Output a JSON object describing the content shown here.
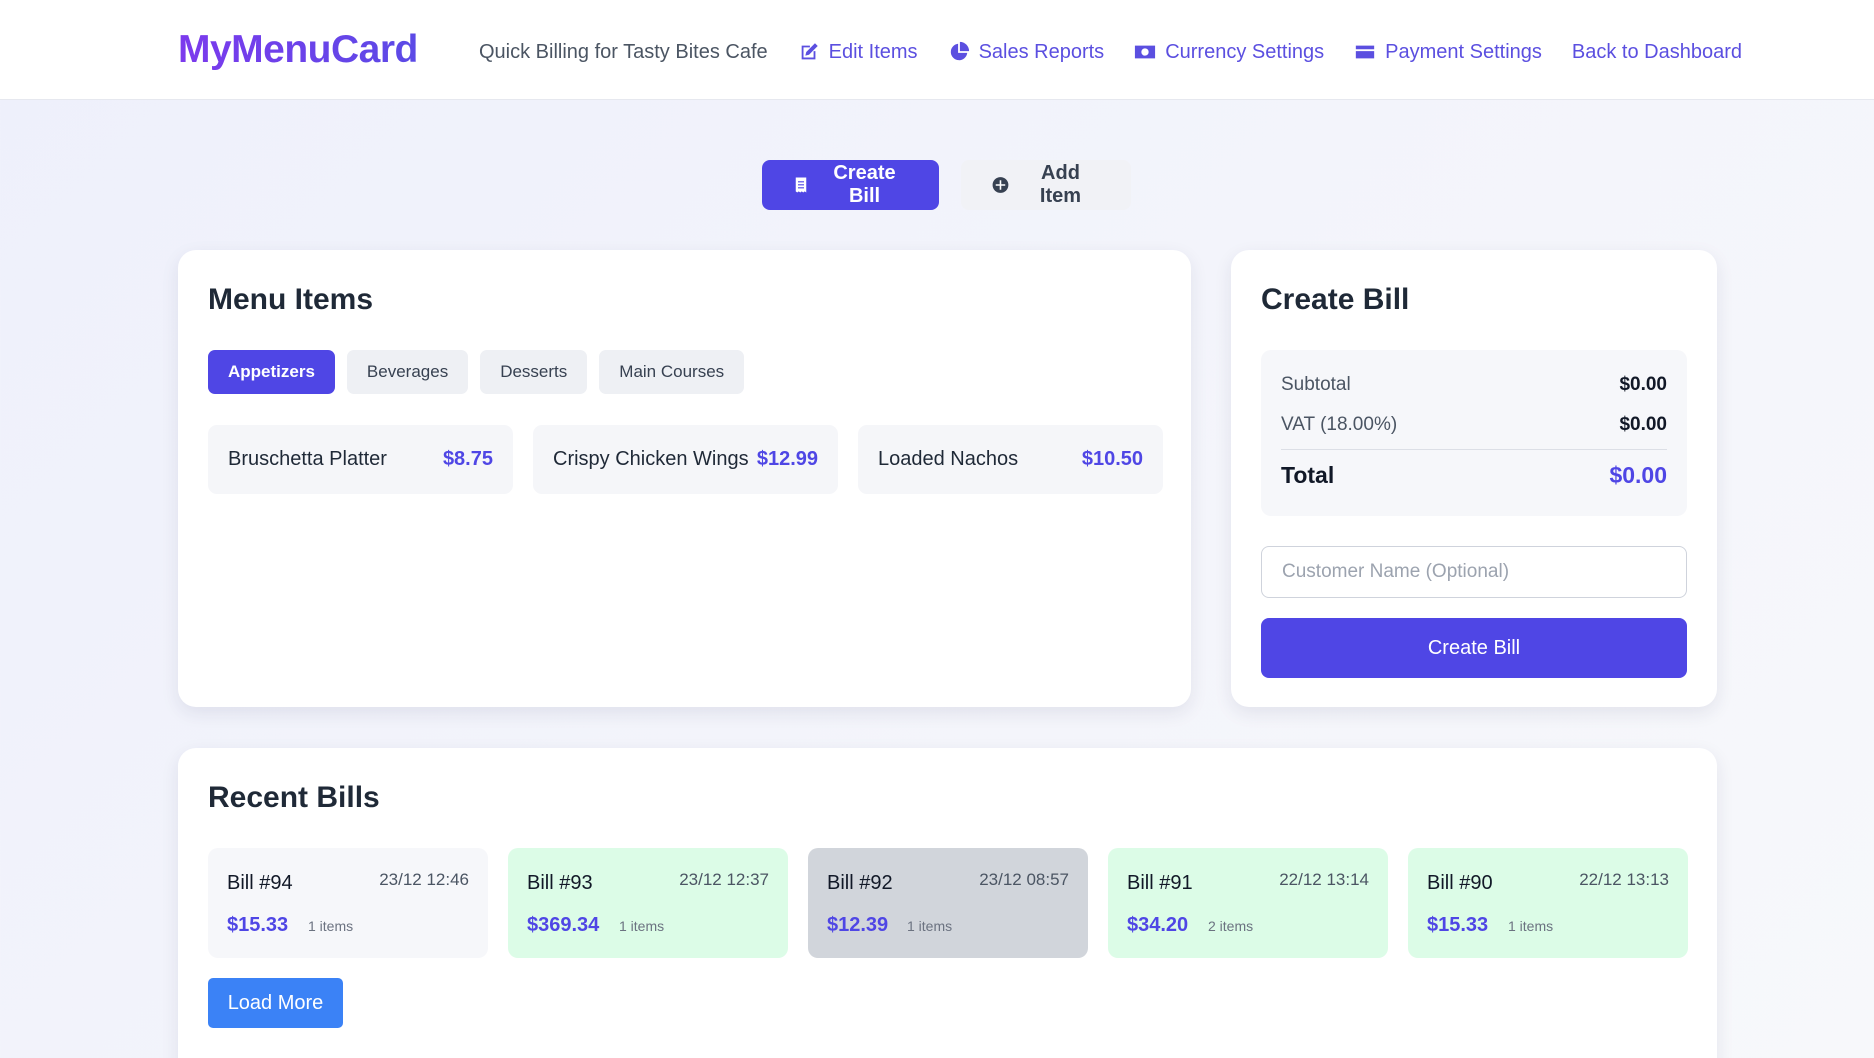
{
  "header": {
    "logo": "MyMenuCard",
    "tagline": "Quick Billing for Tasty Bites Cafe",
    "nav": [
      {
        "label": "Edit Items",
        "icon": "edit-icon"
      },
      {
        "label": "Sales Reports",
        "icon": "pie-chart-icon"
      },
      {
        "label": "Currency Settings",
        "icon": "money-bill-icon"
      },
      {
        "label": "Payment Settings",
        "icon": "credit-card-icon"
      },
      {
        "label": "Back to Dashboard"
      }
    ]
  },
  "top_tabs": {
    "create_bill": "Create Bill",
    "add_item": "Add Item"
  },
  "menu": {
    "title": "Menu Items",
    "categories": [
      "Appetizers",
      "Beverages",
      "Desserts",
      "Main Courses"
    ],
    "active_category": "Appetizers",
    "items": [
      {
        "name": "Bruschetta Platter",
        "price": "$8.75"
      },
      {
        "name": "Crispy Chicken Wings",
        "price": "$12.99"
      },
      {
        "name": "Loaded Nachos",
        "price": "$10.50"
      }
    ]
  },
  "bill": {
    "title": "Create Bill",
    "subtotal_label": "Subtotal",
    "subtotal": "$0.00",
    "vat_label": "VAT (18.00%)",
    "vat": "$0.00",
    "total_label": "Total",
    "total": "$0.00",
    "customer_placeholder": "Customer Name (Optional)",
    "create_button": "Create Bill"
  },
  "recent": {
    "title": "Recent Bills",
    "bills": [
      {
        "number": "Bill #94",
        "date": "23/12 12:46",
        "amount": "$15.33",
        "items": "1 items",
        "status_color": "#f6f7fa"
      },
      {
        "number": "Bill #93",
        "date": "23/12 12:37",
        "amount": "$369.34",
        "items": "1 items",
        "status_color": "#dcfce7"
      },
      {
        "number": "Bill #92",
        "date": "23/12 08:57",
        "amount": "$12.39",
        "items": "1 items",
        "status_color": "#d1d5db"
      },
      {
        "number": "Bill #91",
        "date": "22/12 13:14",
        "amount": "$34.20",
        "items": "2 items",
        "status_color": "#dcfce7"
      },
      {
        "number": "Bill #90",
        "date": "22/12 13:13",
        "amount": "$15.33",
        "items": "1 items",
        "status_color": "#dcfce7"
      }
    ],
    "load_more": "Load More"
  },
  "colors": {
    "accent": "#4f46e5",
    "logo": "#7c3aed",
    "load_more": "#3b82f6"
  }
}
